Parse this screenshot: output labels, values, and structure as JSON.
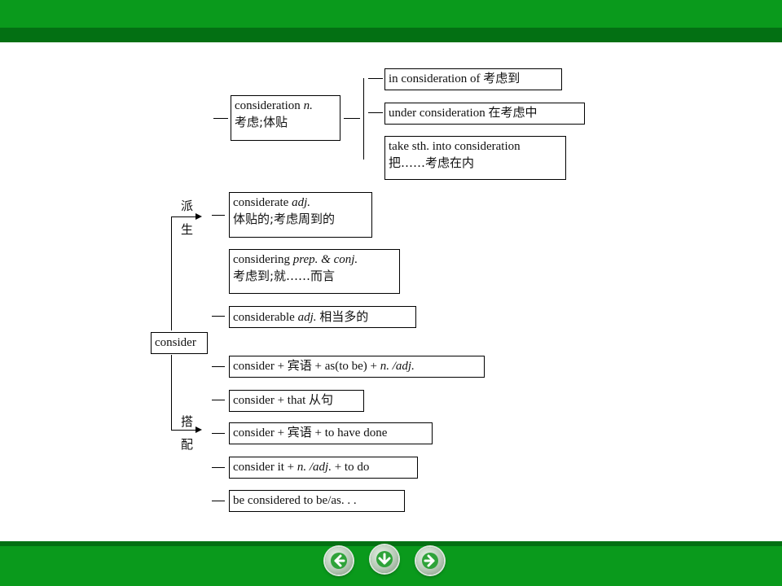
{
  "nodes": {
    "consideration": {
      "line1": "consideration",
      "line1_pos": "n.",
      "line2": "考虑;体贴"
    },
    "in_consideration": {
      "text": "in consideration of 考虑到"
    },
    "under_consideration": {
      "text": "under consideration 在考虑中"
    },
    "take_into": {
      "line1": "take sth. into consideration",
      "line2": "把……考虑在内"
    },
    "considerate": {
      "line1": "considerate",
      "line1_pos": "adj.",
      "line2": "体贴的;考虑周到的"
    },
    "considering": {
      "line1": "considering",
      "line1_pos": "prep. & conj.",
      "line2": "考虑到;就……而言"
    },
    "considerable": {
      "text": "considerable",
      "pos": "adj.",
      "meaning": "相当多的"
    },
    "consider": {
      "text": "consider"
    },
    "c1": {
      "text": "consider + 宾语 + as(to be) + ",
      "tail": "n. /adj."
    },
    "c2": {
      "text": "consider + that 从句"
    },
    "c3": {
      "text": "consider + 宾语 + to have done"
    },
    "c4": {
      "text": "consider it + ",
      "mid": "n. /adj.",
      "tail": " + to do"
    },
    "c5": {
      "text": "be considered to be/as. . ."
    }
  },
  "labels": {
    "derive_1": "派",
    "derive_2": "生",
    "collocate_1": "搭",
    "collocate_2": "配"
  },
  "nav": {
    "prev_icon": "arrow-left-icon",
    "home_icon": "arrow-down-icon",
    "next_icon": "arrow-right-icon"
  },
  "colors": {
    "bar": "#0a9a1c",
    "bar_dark": "#037013"
  }
}
